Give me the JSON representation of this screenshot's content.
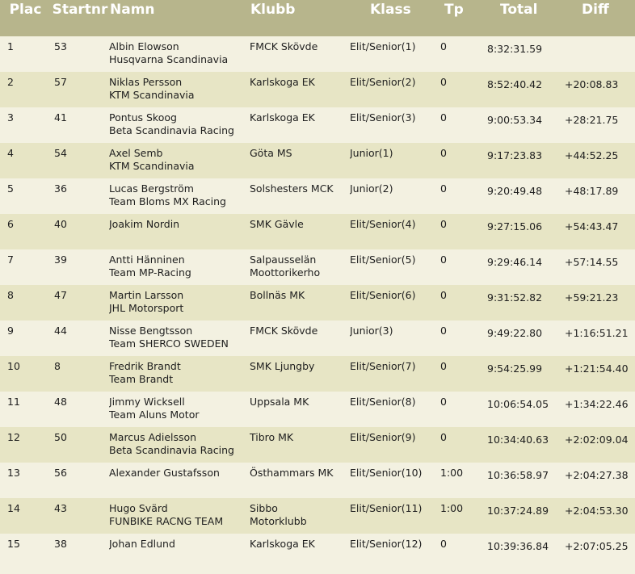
{
  "headers": {
    "plac": "Plac",
    "startnr": "Startnr",
    "namn": "Namn",
    "klubb": "Klubb",
    "klass": "Klass",
    "tp": "Tp",
    "total": "Total",
    "diff": "Diff"
  },
  "rows": [
    {
      "plac": "1",
      "startnr": "53",
      "name": "Albin Elowson",
      "team": "Husqvarna Scandinavia",
      "club1": "FMCK Skövde",
      "club2": "",
      "klass": "Elit/Senior(1)",
      "tp": "0",
      "total": "8:32:31.59",
      "diff": ""
    },
    {
      "plac": "2",
      "startnr": "57",
      "name": "Niklas Persson",
      "team": "KTM Scandinavia",
      "club1": "Karlskoga EK",
      "club2": "",
      "klass": "Elit/Senior(2)",
      "tp": "0",
      "total": "8:52:40.42",
      "diff": "+20:08.83"
    },
    {
      "plac": "3",
      "startnr": "41",
      "name": "Pontus Skoog",
      "team": "Beta Scandinavia Racing",
      "club1": "Karlskoga EK",
      "club2": "",
      "klass": "Elit/Senior(3)",
      "tp": "0",
      "total": "9:00:53.34",
      "diff": "+28:21.75"
    },
    {
      "plac": "4",
      "startnr": "54",
      "name": "Axel Semb",
      "team": "KTM Scandinavia",
      "club1": "Göta MS",
      "club2": "",
      "klass": "Junior(1)",
      "tp": "0",
      "total": "9:17:23.83",
      "diff": "+44:52.25"
    },
    {
      "plac": "5",
      "startnr": "36",
      "name": "Lucas Bergström",
      "team": "Team Bloms MX Racing",
      "club1": "Solshesters MCK",
      "club2": "",
      "klass": "Junior(2)",
      "tp": "0",
      "total": "9:20:49.48",
      "diff": "+48:17.89"
    },
    {
      "plac": "6",
      "startnr": "40",
      "name": "Joakim Nordin",
      "team": "",
      "club1": "SMK Gävle",
      "club2": "",
      "klass": "Elit/Senior(4)",
      "tp": "0",
      "total": "9:27:15.06",
      "diff": "+54:43.47"
    },
    {
      "plac": "7",
      "startnr": "39",
      "name": "Antti Hänninen",
      "team": "Team MP-Racing",
      "club1": "Salpausselän",
      "club2": "Moottorikerho",
      "klass": "Elit/Senior(5)",
      "tp": "0",
      "total": "9:29:46.14",
      "diff": "+57:14.55"
    },
    {
      "plac": "8",
      "startnr": "47",
      "name": "Martin Larsson",
      "team": "JHL Motorsport",
      "club1": "Bollnäs MK",
      "club2": "",
      "klass": "Elit/Senior(6)",
      "tp": "0",
      "total": "9:31:52.82",
      "diff": "+59:21.23"
    },
    {
      "plac": "9",
      "startnr": "44",
      "name": "Nisse Bengtsson",
      "team": "Team SHERCO SWEDEN",
      "club1": "FMCK Skövde",
      "club2": "",
      "klass": "Junior(3)",
      "tp": "0",
      "total": "9:49:22.80",
      "diff": "+1:16:51.21"
    },
    {
      "plac": "10",
      "startnr": "8",
      "name": "Fredrik Brandt",
      "team": "Team Brandt",
      "club1": "SMK Ljungby",
      "club2": "",
      "klass": "Elit/Senior(7)",
      "tp": "0",
      "total": "9:54:25.99",
      "diff": "+1:21:54.40"
    },
    {
      "plac": "11",
      "startnr": "48",
      "name": "Jimmy Wicksell",
      "team": "Team Aluns Motor",
      "club1": "Uppsala MK",
      "club2": "",
      "klass": "Elit/Senior(8)",
      "tp": "0",
      "total": "10:06:54.05",
      "diff": "+1:34:22.46"
    },
    {
      "plac": "12",
      "startnr": "50",
      "name": "Marcus Adielsson",
      "team": "Beta Scandinavia Racing",
      "club1": "Tibro MK",
      "club2": "",
      "klass": "Elit/Senior(9)",
      "tp": "0",
      "total": "10:34:40.63",
      "diff": "+2:02:09.04"
    },
    {
      "plac": "13",
      "startnr": "56",
      "name": "Alexander Gustafsson",
      "team": "",
      "club1": "Östhammars MK",
      "club2": "",
      "klass": "Elit/Senior(10)",
      "tp": "1:00",
      "total": "10:36:58.97",
      "diff": "+2:04:27.38"
    },
    {
      "plac": "14",
      "startnr": "43",
      "name": "Hugo Svärd",
      "team": "FUNBIKE RACNG TEAM",
      "club1": "Sibbo",
      "club2": "Motorklubb",
      "klass": "Elit/Senior(11)",
      "tp": "1:00",
      "total": "10:37:24.89",
      "diff": "+2:04:53.30"
    },
    {
      "plac": "15",
      "startnr": "38",
      "name": "Johan Edlund",
      "team": "",
      "club1": "Karlskoga EK",
      "club2": "",
      "klass": "Elit/Senior(12)",
      "tp": "0",
      "total": "10:39:36.84",
      "diff": "+2:07:05.25"
    }
  ]
}
